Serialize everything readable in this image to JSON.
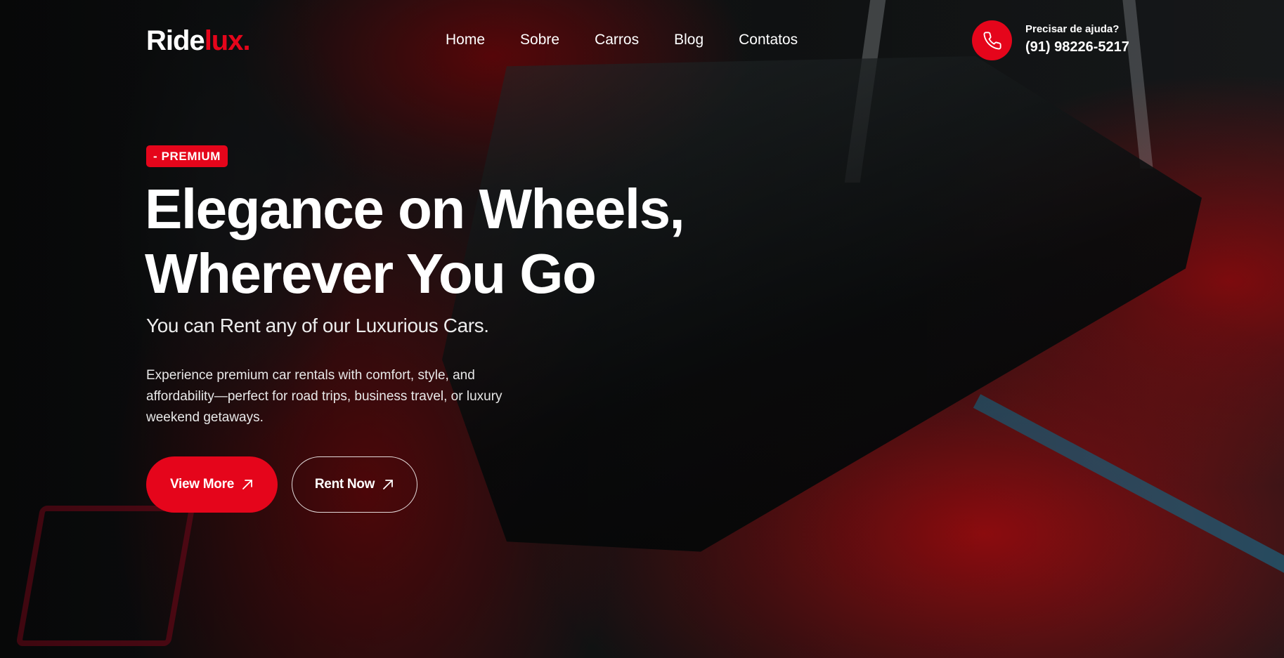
{
  "brand": {
    "logo_main": "Ride",
    "logo_accent": "lux",
    "logo_dot": ".",
    "accent_color": "#e5051b"
  },
  "nav": {
    "items": [
      {
        "label": "Home"
      },
      {
        "label": "Sobre"
      },
      {
        "label": "Carros"
      },
      {
        "label": "Blog"
      },
      {
        "label": "Contatos"
      }
    ]
  },
  "contact": {
    "icon": "phone-icon",
    "label": "Precisar de ajuda?",
    "phone": "(91) 98226-5217"
  },
  "hero": {
    "badge": "- PREMIUM",
    "title_line1": "Elegance on Wheels,",
    "title_line2": "Wherever You Go",
    "subtitle": "You can Rent any of our Luxurious Cars.",
    "description": "Experience premium car rentals with comfort, style, and affordability—perfect for road trips, business travel, or luxury weekend getaways.",
    "buttons": {
      "primary": {
        "label": "View More",
        "icon": "arrow-up-right-icon"
      },
      "secondary": {
        "label": "Rent Now",
        "icon": "arrow-up-right-icon"
      }
    }
  }
}
